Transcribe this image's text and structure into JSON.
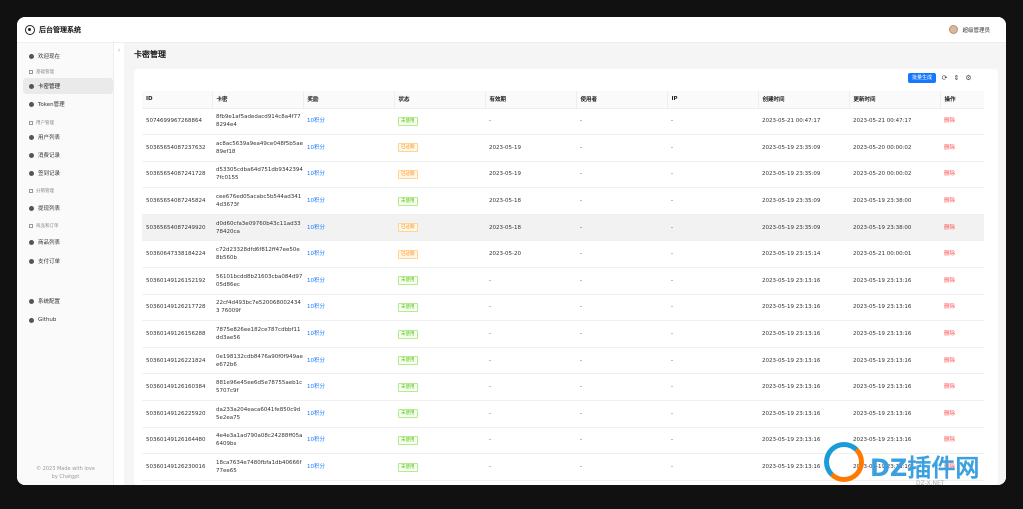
{
  "app": {
    "title": "后台管理系统",
    "user": "超级管理员"
  },
  "sidebar": {
    "welcome": "欢迎现在",
    "groups": [
      "基础管理",
      "用户管理",
      "分销管理",
      "商品和订单"
    ],
    "items": [
      "卡密管理",
      "Token管理",
      "用户列表",
      "消费记录",
      "签到记录",
      "提现列表",
      "商品列表",
      "支付订单",
      "系统配置",
      "Github"
    ],
    "footer": [
      "© 2023 Made with love",
      "by Chatgpt"
    ],
    "collapse": "‹"
  },
  "page": {
    "title": "卡密管理"
  },
  "toolbar": {
    "batch_label": "批量生成",
    "icons": [
      "refresh-icon",
      "column-height-icon",
      "settings-icon"
    ]
  },
  "table": {
    "headers": [
      "ID",
      "卡密",
      "奖励",
      "状态",
      "有效期",
      "使用者",
      "IP",
      "创建时间",
      "更新时间",
      "操作"
    ],
    "rows": [
      [
        "507469996726886​4",
        "8fb9e1af5adedacd914c8a4f778294e4",
        "10积分",
        "未使用",
        "-",
        "-",
        "-",
        "2023-05-21 00:47:17",
        "2023-05-21 00:47:17",
        "删除"
      ],
      [
        "5036565408723763​2",
        "ac8ac5639a9ea49ce048f5b5ae89ef18",
        "10积分",
        "已过期",
        "2023-05-19",
        "-",
        "-",
        "2023-05-19 23:35:09",
        "2023-05-20 00:00:02",
        "删除"
      ],
      [
        "5036565408724172​8",
        "d53305cdba64d751db93423947fc0155",
        "10积分",
        "已过期",
        "2023-05-19",
        "-",
        "-",
        "2023-05-19 23:35:09",
        "2023-05-20 00:00:02",
        "删除"
      ],
      [
        "5036565408724582​4",
        "cee676ed05acabc5b544ad3414d3673f",
        "10积分",
        "未使用",
        "2023-05-18",
        "-",
        "-",
        "2023-05-19 23:35:09",
        "2023-05-19 23:38:00",
        "删除"
      ],
      [
        "5036565408724992​0",
        "d0d60cfa3e09760b43c11ad3378420ca",
        "10积分",
        "已过期",
        "2023-05-18",
        "-",
        "-",
        "2023-05-19 23:35:09",
        "2023-05-19 23:38:00",
        "删除"
      ],
      [
        "5036064733818422​4",
        "c72d23328dfd6f812ff47ee50e8b560b",
        "10积分",
        "已过期",
        "2023-05-20",
        "-",
        "-",
        "2023-05-19 23:15:14",
        "2023-05-21 00:00:01",
        "删除"
      ],
      [
        "5036014912615219​2",
        "56101bcdd8b21603cba084d9705d86ec",
        "10积分",
        "未使用",
        "-",
        "-",
        "-",
        "2023-05-19 23:13:16",
        "2023-05-19 23:13:16",
        "删除"
      ],
      [
        "5036014912621772​8",
        "22cf4d493bc7e5200680024343 76009f",
        "10积分",
        "未使用",
        "-",
        "-",
        "-",
        "2023-05-19 23:13:16",
        "2023-05-19 23:13:16",
        "删除"
      ],
      [
        "5036014912615628​8",
        "7875e826ee182ce787cdbbf11dd3ae56",
        "10积分",
        "未使用",
        "-",
        "-",
        "-",
        "2023-05-19 23:13:16",
        "2023-05-19 23:13:16",
        "删除"
      ],
      [
        "5036014912622182​4",
        "0e198132cdb8476a90f0f949aee672b6",
        "10积分",
        "未使用",
        "-",
        "-",
        "-",
        "2023-05-19 23:13:16",
        "2023-05-19 23:13:16",
        "删除"
      ],
      [
        "5036014912616038​4",
        "881e96e45ee6d5e78755aeb1c5707c9f",
        "10积分",
        "未使用",
        "-",
        "-",
        "-",
        "2023-05-19 23:13:16",
        "2023-05-19 23:13:16",
        "删除"
      ],
      [
        "5036014912622592​0",
        "da233a204eaca6041fe850c9d5e2ea75",
        "10积分",
        "未使用",
        "-",
        "-",
        "-",
        "2023-05-19 23:13:16",
        "2023-05-19 23:13:16",
        "删除"
      ],
      [
        "5036014912616448​0",
        "4e4e3a1ad790a08c24288ff05a6409bs",
        "10积分",
        "未使用",
        "-",
        "-",
        "-",
        "2023-05-19 23:13:16",
        "2023-05-19 23:13:16",
        "删除"
      ],
      [
        "5036014912623001​6",
        "18ca7634e7480fbfa1db40666f77ee65",
        "10积分",
        "未使用",
        "-",
        "-",
        "-",
        "2023-05-19 23:13:16",
        "2023-05-19 23:13:16",
        "删除"
      ]
    ],
    "status_colors": {
      "未使用": "#52c41a",
      "已过期": "#fa8c16"
    }
  },
  "watermark": {
    "text": "DZ插件网",
    "url": "DZ-X.NET"
  }
}
